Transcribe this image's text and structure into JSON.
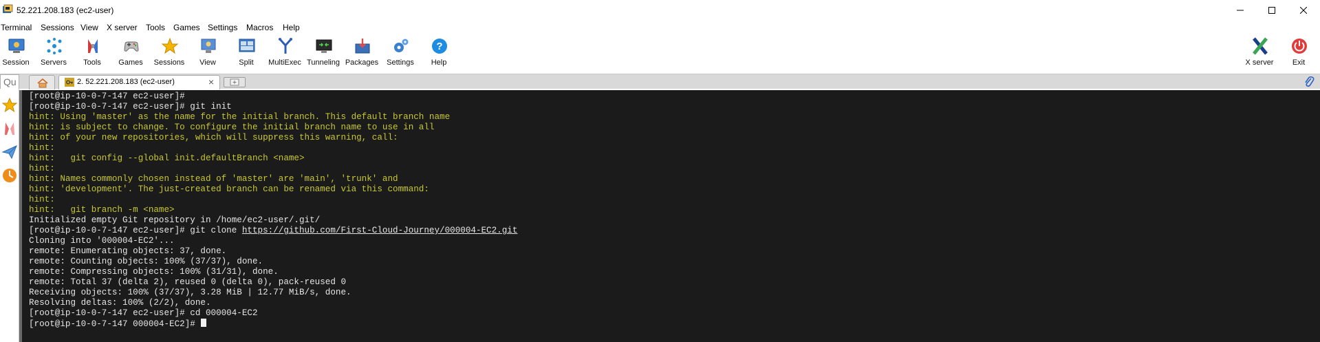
{
  "window": {
    "title": "52.221.208.183 (ec2-user)"
  },
  "menu": [
    "Terminal",
    "Sessions",
    "View",
    "X server",
    "Tools",
    "Games",
    "Settings",
    "Macros",
    "Help"
  ],
  "toolbar": {
    "left": [
      {
        "label": "Session",
        "icon": "session-icon"
      },
      {
        "label": "Servers",
        "icon": "servers-icon"
      },
      {
        "label": "Tools",
        "icon": "tools-icon"
      },
      {
        "label": "Games",
        "icon": "games-icon"
      },
      {
        "label": "Sessions",
        "icon": "sessions-star-icon"
      },
      {
        "label": "View",
        "icon": "view-icon"
      },
      {
        "label": "Split",
        "icon": "split-icon"
      },
      {
        "label": "MultiExec",
        "icon": "multiexec-icon"
      },
      {
        "label": "Tunneling",
        "icon": "tunneling-icon"
      },
      {
        "label": "Packages",
        "icon": "packages-icon"
      },
      {
        "label": "Settings",
        "icon": "settings-gear-icon"
      },
      {
        "label": "Help",
        "icon": "help-icon"
      }
    ],
    "right": [
      {
        "label": "X server",
        "icon": "xserver-icon"
      },
      {
        "label": "Exit",
        "icon": "power-icon"
      }
    ]
  },
  "tabs": {
    "quick_connect_value": "Qu",
    "session_tab_label": "2. 52.221.208.183 (ec2-user)",
    "close_glyph": "×"
  },
  "terminal": {
    "lines": [
      {
        "text": "[root@ip-10-0-7-147 ec2-user]#",
        "kind": "normal"
      },
      {
        "text": "[root@ip-10-0-7-147 ec2-user]# git init",
        "kind": "normal"
      },
      {
        "text": "hint: Using 'master' as the name for the initial branch. This default branch name",
        "kind": "hint"
      },
      {
        "text": "hint: is subject to change. To configure the initial branch name to use in all",
        "kind": "hint"
      },
      {
        "text": "hint: of your new repositories, which will suppress this warning, call:",
        "kind": "hint"
      },
      {
        "text": "hint:",
        "kind": "hint"
      },
      {
        "text": "hint:   git config --global init.defaultBranch <name>",
        "kind": "hint"
      },
      {
        "text": "hint:",
        "kind": "hint"
      },
      {
        "text": "hint: Names commonly chosen instead of 'master' are 'main', 'trunk' and",
        "kind": "hint"
      },
      {
        "text": "hint: 'development'. The just-created branch can be renamed via this command:",
        "kind": "hint"
      },
      {
        "text": "hint:",
        "kind": "hint"
      },
      {
        "text": "hint:   git branch -m <name>",
        "kind": "hint"
      },
      {
        "text": "Initialized empty Git repository in /home/ec2-user/.git/",
        "kind": "normal"
      },
      {
        "text": "[root@ip-10-0-7-147 ec2-user]# git clone ",
        "kind": "normal",
        "link": "https://github.com/First-Cloud-Journey/000004-EC2.git"
      },
      {
        "text": "Cloning into '000004-EC2'...",
        "kind": "normal"
      },
      {
        "text": "remote: Enumerating objects: 37, done.",
        "kind": "normal"
      },
      {
        "text": "remote: Counting objects: 100% (37/37), done.",
        "kind": "normal"
      },
      {
        "text": "remote: Compressing objects: 100% (31/31), done.",
        "kind": "normal"
      },
      {
        "text": "remote: Total 37 (delta 2), reused 0 (delta 0), pack-reused 0",
        "kind": "normal"
      },
      {
        "text": "Receiving objects: 100% (37/37), 3.28 MiB | 12.77 MiB/s, done.",
        "kind": "normal"
      },
      {
        "text": "Resolving deltas: 100% (2/2), done.",
        "kind": "normal"
      },
      {
        "text": "[root@ip-10-0-7-147 ec2-user]# cd 000004-EC2",
        "kind": "normal"
      },
      {
        "text": "[root@ip-10-0-7-147 000004-EC2]# ",
        "kind": "normal",
        "cursor": true
      }
    ]
  },
  "colors": {
    "terminal_bg": "#1b1b1b",
    "terminal_fg": "#e6e6e6",
    "hint_fg": "#c8c832"
  }
}
